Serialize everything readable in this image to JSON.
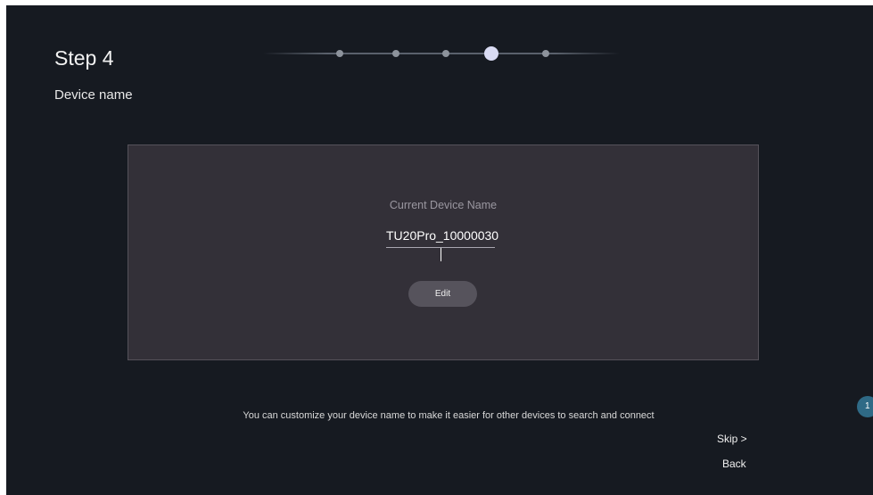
{
  "header": {
    "step_title": "Step 4",
    "subtitle": "Device name"
  },
  "progress": {
    "total_steps": 5,
    "current_step": 4
  },
  "panel": {
    "field_label": "Current Device Name",
    "device_name_value": "TU20Pro_10000030",
    "edit_label": "Edit"
  },
  "footer": {
    "hint": "You can customize your device name to make it easier for other devices to search and connect",
    "skip_label": "Skip >",
    "back_label": "Back"
  },
  "badge": {
    "text": "1"
  },
  "colors": {
    "background": "#161a21",
    "panel": "#333038",
    "active_dot": "#d9dbf3",
    "inactive_dot": "#8d939c",
    "badge": "#2f6a86"
  }
}
